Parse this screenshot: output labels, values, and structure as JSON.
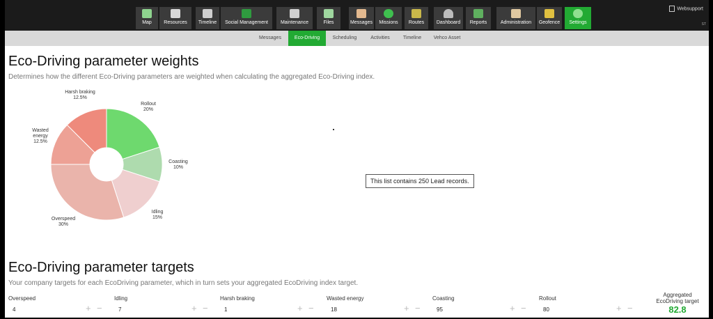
{
  "nav": {
    "items": [
      {
        "label": "Map",
        "icon": "map-icon"
      },
      {
        "label": "Resources",
        "icon": "resources-icon"
      },
      {
        "label": "Timeline",
        "icon": "timeline-icon"
      },
      {
        "label": "Social Management",
        "icon": "social-icon"
      },
      {
        "label": "Maintenance",
        "icon": "maintenance-icon"
      },
      {
        "label": "Files",
        "icon": "files-icon"
      },
      {
        "label": "Messages",
        "icon": "envelope-icon"
      },
      {
        "label": "Missions",
        "icon": "missions-icon"
      },
      {
        "label": "Routes",
        "icon": "routes-icon"
      },
      {
        "label": "Dashboard",
        "icon": "gauge-icon"
      },
      {
        "label": "Reports",
        "icon": "reports-icon"
      },
      {
        "label": "Administration",
        "icon": "clipboard-icon"
      },
      {
        "label": "Geofence",
        "icon": "geofence-icon"
      },
      {
        "label": "Settings",
        "icon": "gear-icon"
      }
    ],
    "active": "Settings",
    "user_label": "Websupport",
    "user_sub": "ST"
  },
  "subnav": {
    "items": [
      "Messages",
      "Eco-Driving",
      "Scheduling",
      "Activities",
      "Timeline",
      "Vehco Asset"
    ],
    "active": "Eco-Driving"
  },
  "weights": {
    "title": "Eco-Driving parameter weights",
    "description": "Determines how the different Eco-Driving parameters are weighted when calculating the aggregated Eco-Driving index."
  },
  "chart_data": {
    "type": "pie",
    "donut": true,
    "slices": [
      {
        "label": "Rollout",
        "value": 20,
        "display": "20%",
        "color": "#6ed96e"
      },
      {
        "label": "Coasting",
        "value": 10,
        "display": "10%",
        "color": "#aedbae"
      },
      {
        "label": "Idling",
        "value": 15,
        "display": "15%",
        "color": "#efcfcf"
      },
      {
        "label": "Overspeed",
        "value": 30,
        "display": "30%",
        "color": "#eab4ab"
      },
      {
        "label": "Wasted energy",
        "value": 12.5,
        "display": "12.5%",
        "color": "#eda195"
      },
      {
        "label": "Harsh braking",
        "value": 12.5,
        "display": "12.5%",
        "color": "#ee8a7c"
      }
    ]
  },
  "tooltip": "This list contains 250 Lead records.",
  "targets": {
    "title": "Eco-Driving parameter targets",
    "description": "Your company targets for each EcoDriving parameter, which in turn sets your aggregated EcoDriving index target.",
    "items": [
      {
        "name": "Overspeed",
        "value": "4"
      },
      {
        "name": "Idling",
        "value": "7"
      },
      {
        "name": "Harsh braking",
        "value": "1"
      },
      {
        "name": "Wasted energy",
        "value": "18"
      },
      {
        "name": "Coasting",
        "value": "95"
      },
      {
        "name": "Rollout",
        "value": "80"
      }
    ],
    "aggregated_label": "Aggregated EcoDriving target",
    "aggregated_value": "82.8"
  }
}
